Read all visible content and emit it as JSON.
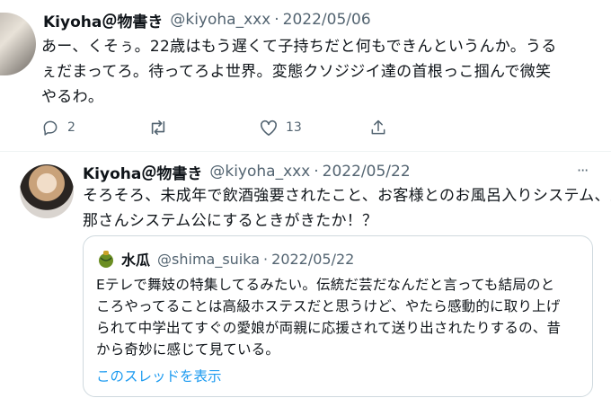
{
  "tweet1": {
    "author_name": "Kiyoha＠物書き",
    "handle": "@kiyoha_xxx",
    "separator": "·",
    "date": "2022/05/06",
    "lines": [
      "あー、くそぅ。22歳はもう遅くて子持ちだと何もできんというんか。うる",
      "ぇだまってろ。待ってろよ世界。変態クソジジイ達の首根っこ掴んで微笑",
      "やるわ。"
    ],
    "actions": {
      "replies": "2",
      "retweets": "",
      "likes": "13"
    }
  },
  "tweet2": {
    "author_name": "Kiyoha＠物書き",
    "handle": "@kiyoha_xxx",
    "separator": "·",
    "date": "2022/05/22",
    "lines": [
      "そろそろ、未成年で飲酒強要されたこと、お客様とのお風呂入りシステム、旦",
      "那さんシステム公にするときがきたか！？"
    ],
    "more_menu": "···",
    "quote": {
      "author_name": "水瓜",
      "handle": "@shima_suika",
      "separator": "·",
      "date": "2022/05/22",
      "lines": [
        "Eテレで舞妓の特集してるみたい。伝統だ芸だなんだと言っても結局のと",
        "ころやってることは高級ホステスだと思うけど、やたら感動的に取り上げ",
        "られて中学出てすぐの愛娘が両親に応援されて送り出されたりするの、昔",
        "から奇妙に感じて見ている。"
      ],
      "show_thread": "このスレッドを表示"
    }
  },
  "icons": [
    "reply-icon",
    "retweet-icon",
    "like-icon",
    "share-icon",
    "more-icon",
    "watermelon-avatar-icon"
  ],
  "colors": {
    "link": "#1d9bf0",
    "muted": "#536471",
    "text": "#0f1419",
    "border": "#cfd9de"
  }
}
